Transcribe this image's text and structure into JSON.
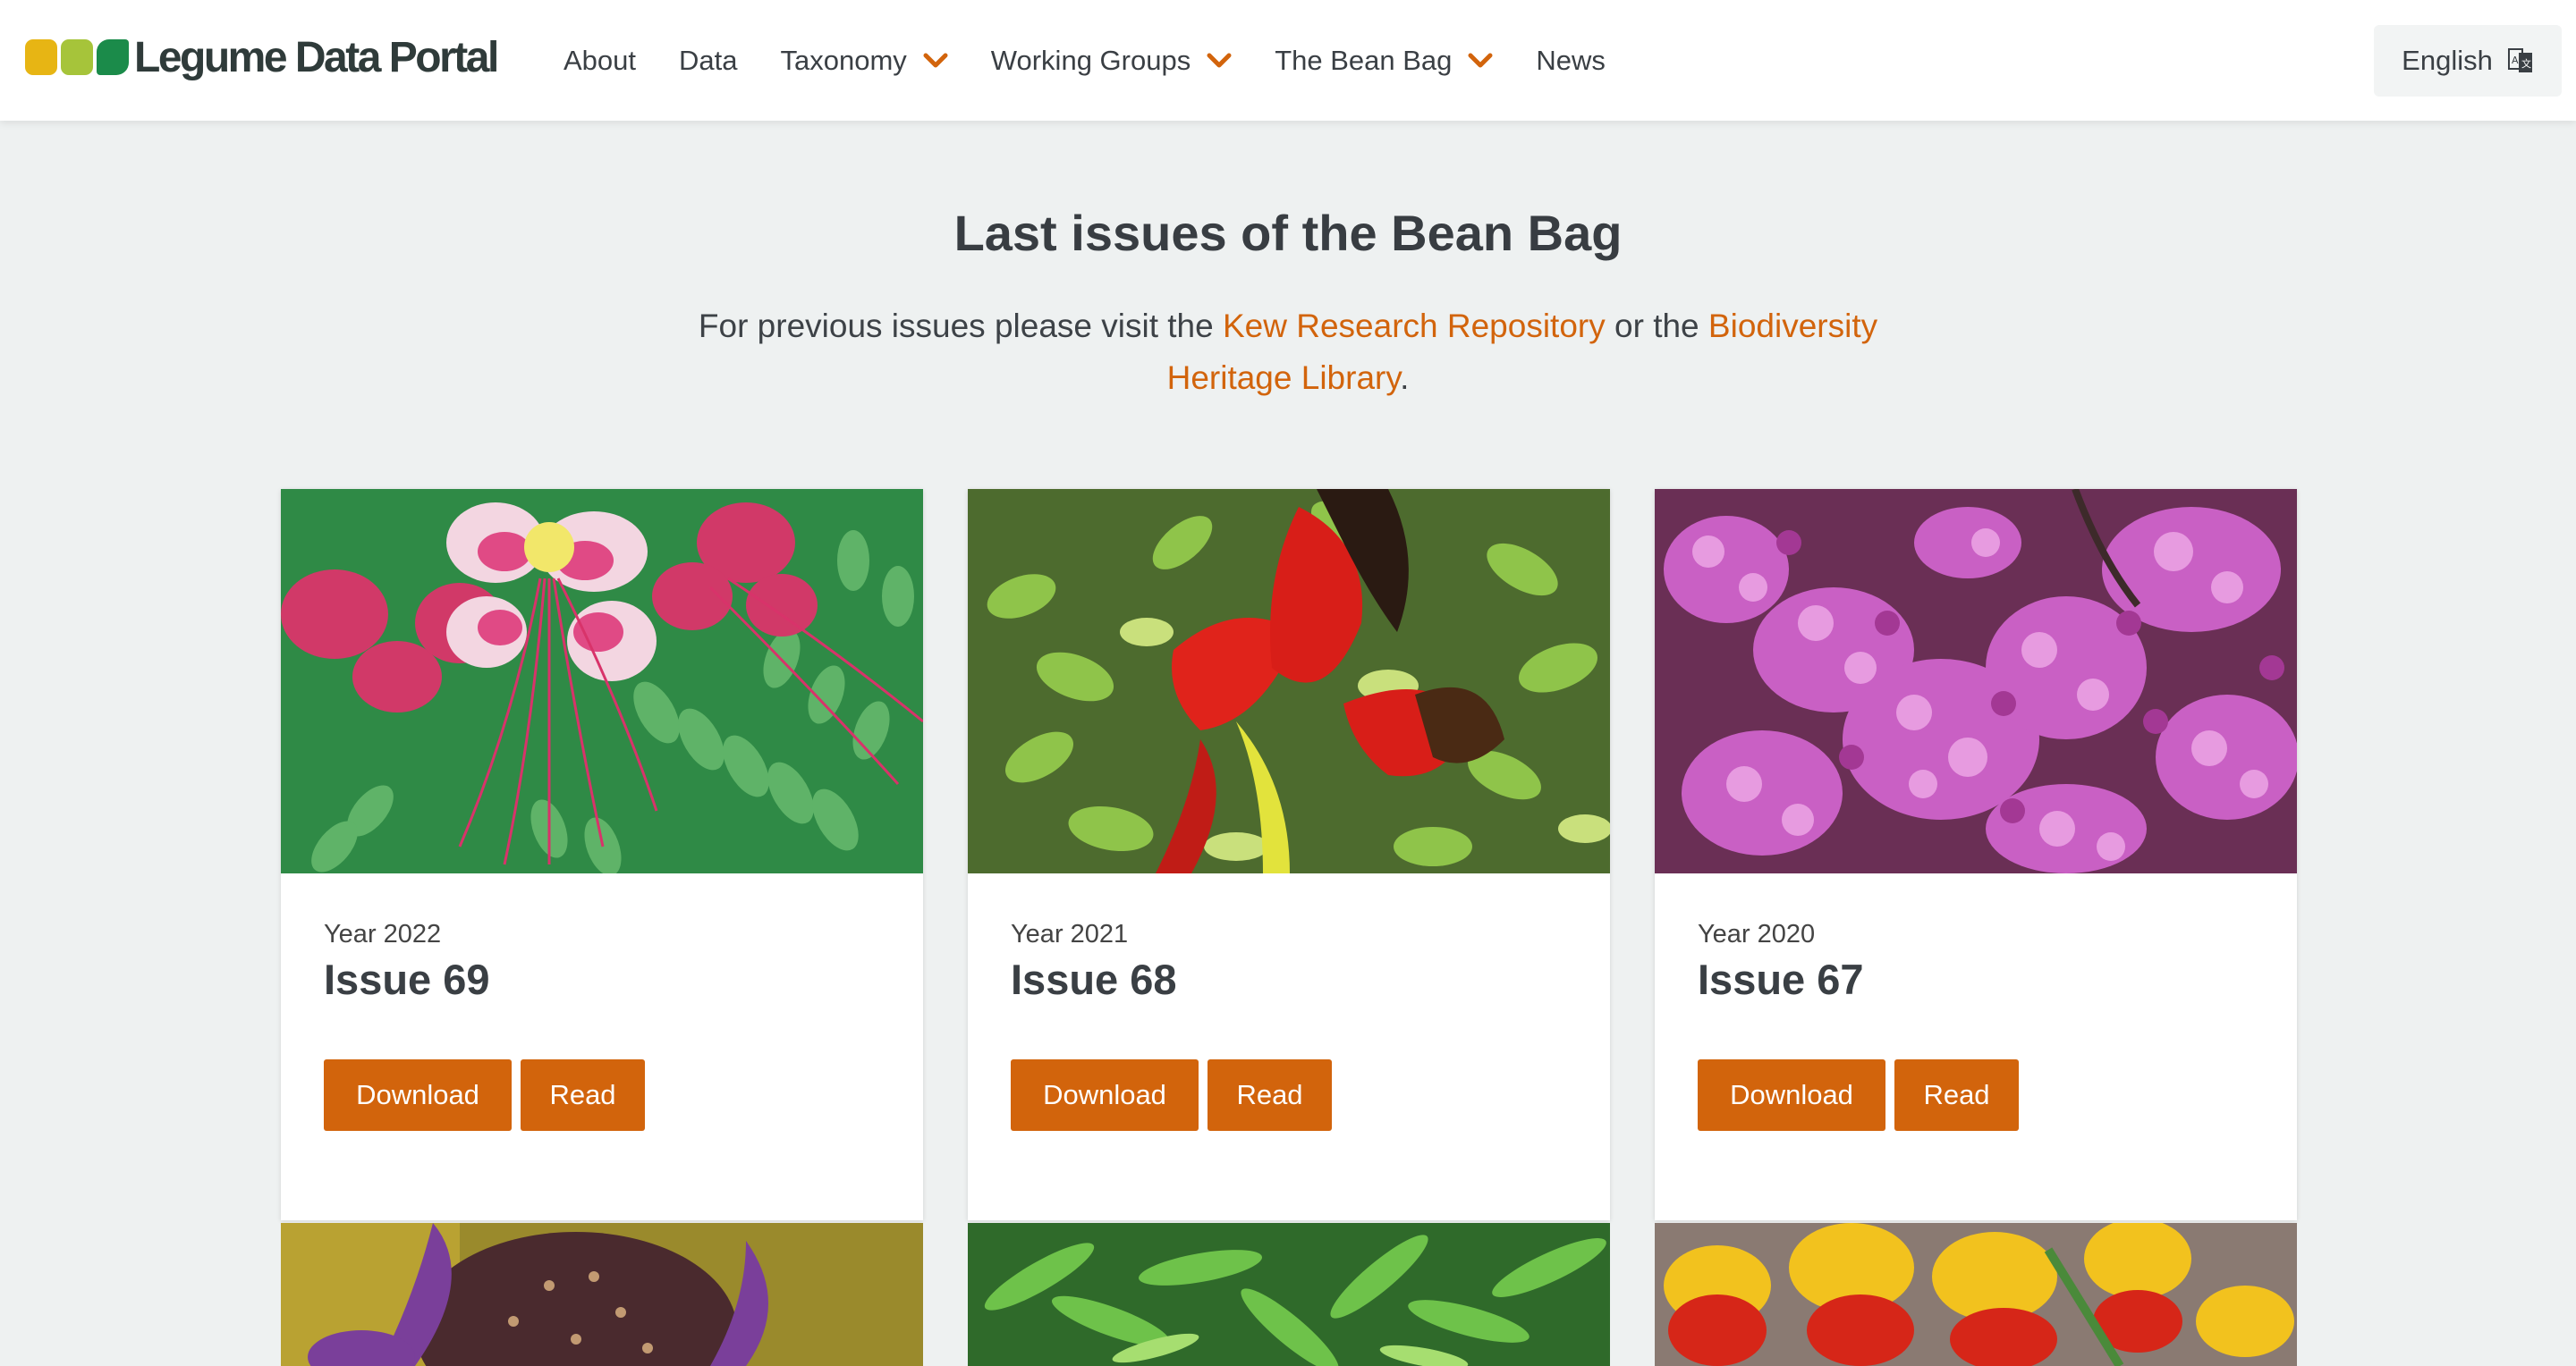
{
  "header": {
    "logo_text": "Legume Data Portal",
    "nav": [
      {
        "label": "About",
        "dropdown": false
      },
      {
        "label": "Data",
        "dropdown": false
      },
      {
        "label": "Taxonomy",
        "dropdown": true
      },
      {
        "label": "Working Groups",
        "dropdown": true
      },
      {
        "label": "The Bean Bag",
        "dropdown": true
      },
      {
        "label": "News",
        "dropdown": false
      }
    ],
    "language": "English",
    "language_icon": "translate-icon"
  },
  "main": {
    "title": "Last issues of the Bean Bag",
    "intro_prefix": "For previous issues please visit the ",
    "link1": "Kew Research Repository",
    "intro_mid": " or the ",
    "link2": "Biodiversity Heritage Library",
    "intro_suffix": "."
  },
  "issues": [
    {
      "year": "Year 2022",
      "issue": "Issue 69",
      "download": "Download",
      "read": "Read",
      "image": "pink-white-flower-photo"
    },
    {
      "year": "Year 2021",
      "issue": "Issue 68",
      "download": "Download",
      "read": "Read",
      "image": "red-flower-photo"
    },
    {
      "year": "Year 2020",
      "issue": "Issue 67",
      "download": "Download",
      "read": "Read",
      "image": "magenta-blossoms-photo"
    }
  ],
  "more_images": [
    "purple-flower-photo",
    "green-leaves-photo",
    "yellow-red-flowers-photo"
  ],
  "colors": {
    "accent": "#d2640c",
    "background": "#eef1f1"
  }
}
